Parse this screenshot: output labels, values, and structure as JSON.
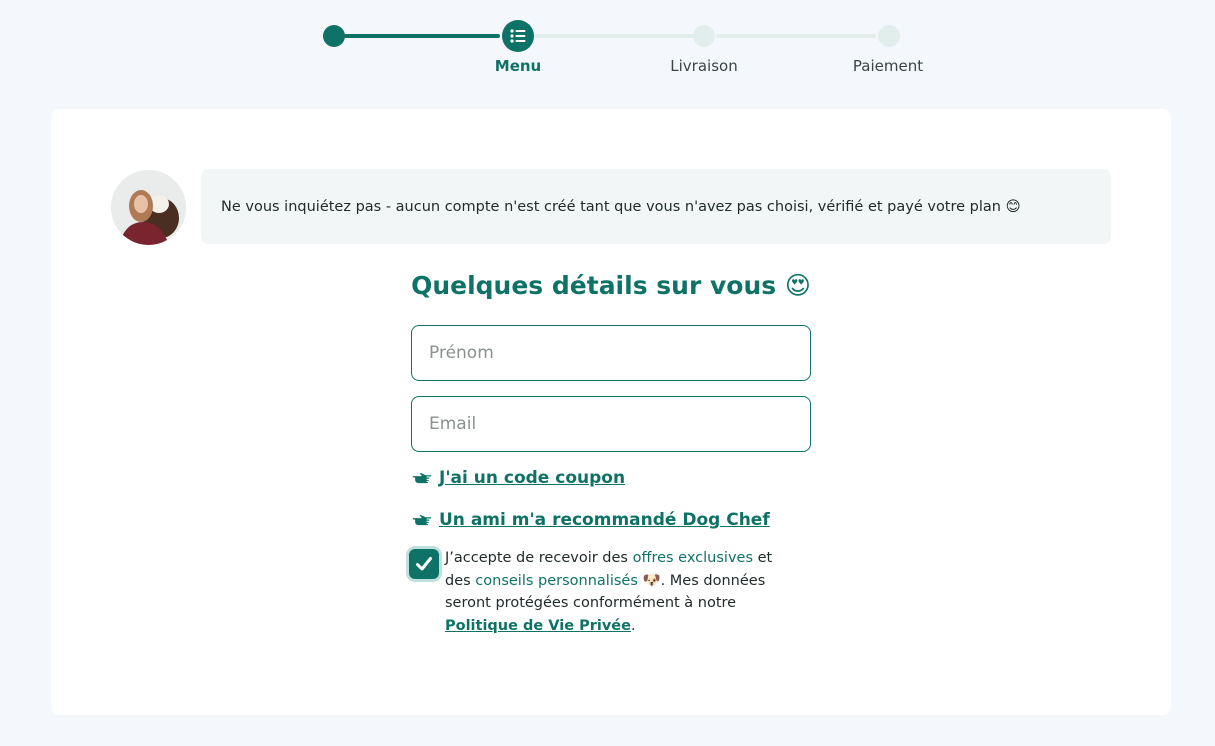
{
  "stepper": {
    "steps": [
      {
        "label": "Menu",
        "state": "active"
      },
      {
        "label": "Livraison",
        "state": "pending"
      },
      {
        "label": "Paiement",
        "state": "pending"
      }
    ]
  },
  "notice": {
    "text": "Ne vous inquiétez pas - aucun compte n'est créé tant que vous n'avez pas choisi, vérifié et payé votre plan 😊"
  },
  "form": {
    "title": "Quelques détails sur vous 😍",
    "first_name": {
      "placeholder": "Prénom",
      "value": ""
    },
    "email": {
      "placeholder": "Email",
      "value": ""
    },
    "coupon_link": "J'ai un code coupon",
    "referral_link": "Un ami m'a recommandé Dog Chef",
    "consent": {
      "checked": true,
      "part1": "J’accepte de recevoir des ",
      "highlight1": "offres exclusives",
      "part2": " et des ",
      "highlight2": "conseils personnalisés",
      "emoji": " 🐶",
      "part3": ". Mes données seront protégées conformément à notre ",
      "policy_link": "Politique de Vie Privée",
      "end": "."
    }
  },
  "colors": {
    "accent": "#0f7266",
    "track_pending": "#e1eeec",
    "background": "#f4f8fd"
  },
  "icons": {
    "active_step": "list-icon",
    "link_prefix": "pointing-hand-icon",
    "checkbox": "checkmark-icon"
  }
}
